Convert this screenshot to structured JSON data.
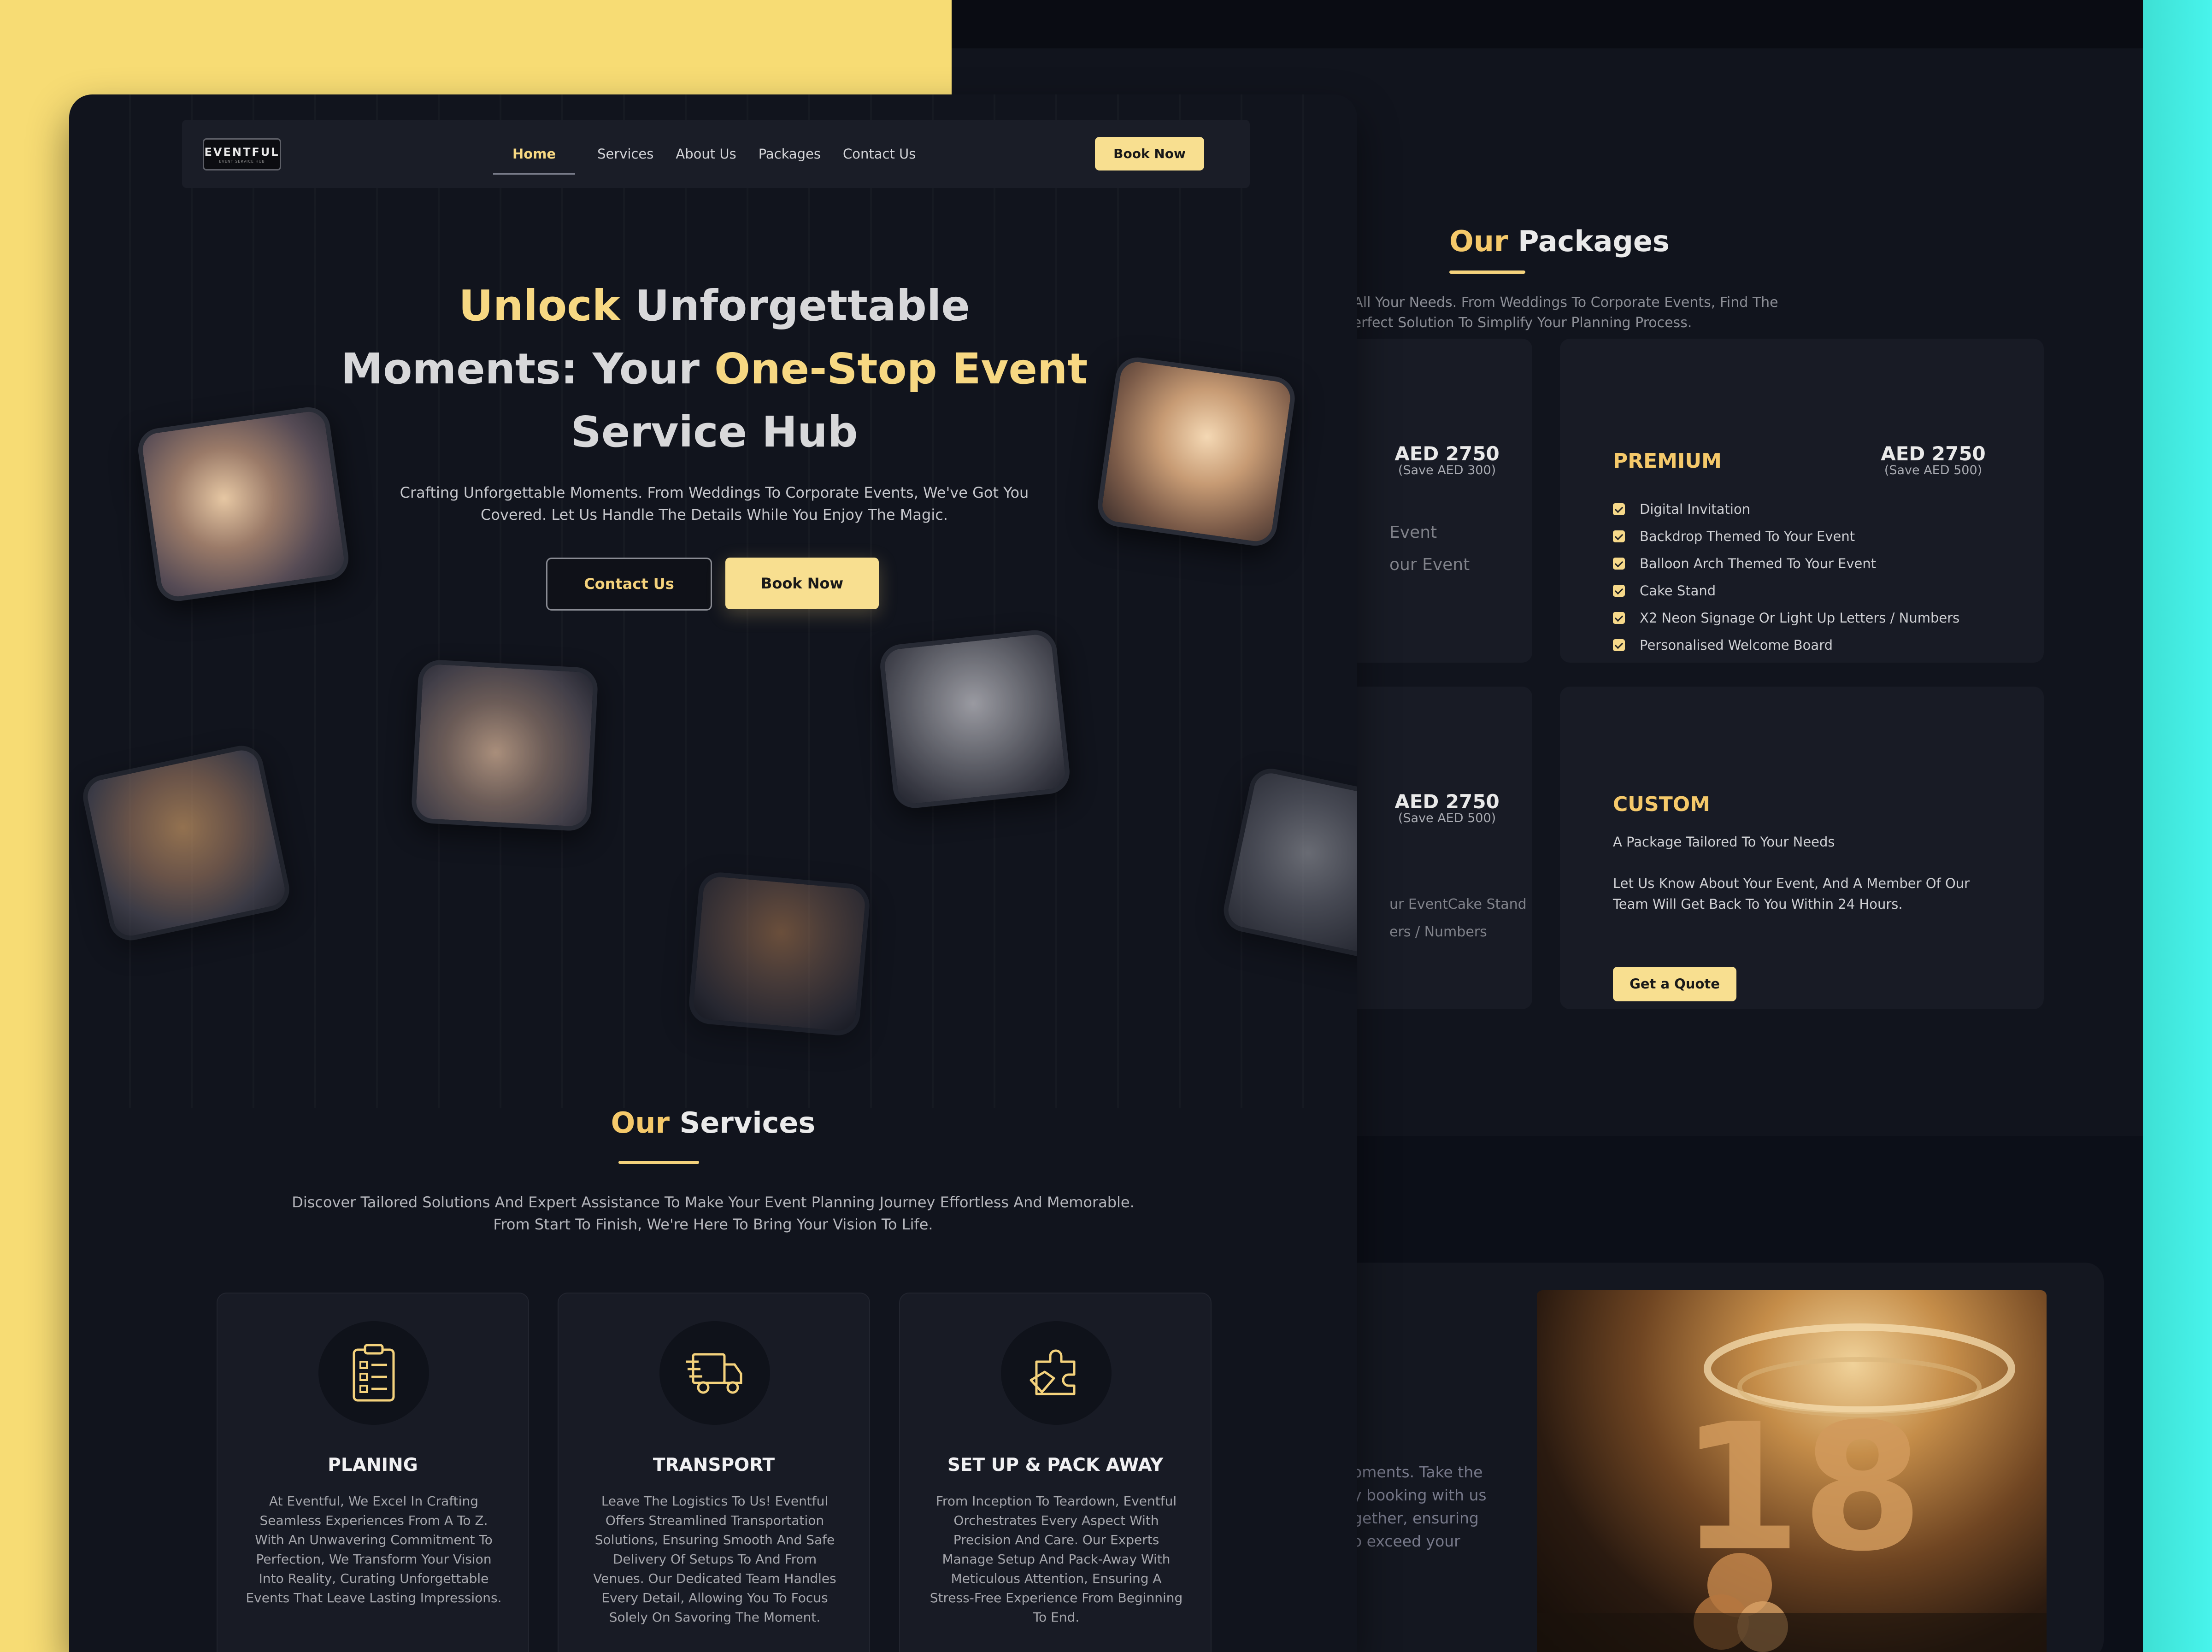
{
  "packages": {
    "heading_pre": "Our",
    "heading_post": "Packages",
    "subtitle_line1": "Packages For All Your Needs. From Weddings To Corporate Events, Find The",
    "subtitle_line2": "Perfect Solution To Simplify Your Planning Process.",
    "cards": [
      {
        "price": "AED 2750",
        "save": "(Save AED 300)",
        "partial_lines": [
          "Event",
          "our Event"
        ]
      },
      {
        "title": "PREMIUM",
        "price": "AED 2750",
        "save": "(Save AED 500)",
        "features": [
          "Digital Invitation",
          "Backdrop Themed To Your Event",
          "Balloon Arch Themed To Your Event",
          "Cake Stand",
          "X2 Neon Signage Or Light Up Letters / Numbers",
          "Personalised Welcome Board"
        ]
      },
      {
        "price": "AED 2750",
        "save": "(Save AED 500)",
        "partial_lines": [
          "ur EventCake Stand",
          "ers / Numbers"
        ]
      },
      {
        "title": "CUSTOM",
        "tagline": "A Package Tailored To Your Needs",
        "desc_line1": "Let Us Know About Your Event, And A Member Of Our",
        "desc_line2": "Team Will Get Back To You Within 24 Hours.",
        "button": "Get a Quote"
      }
    ]
  },
  "about": {
    "lines": [
      "oments. Take the",
      "y booking with us",
      "gether, ensuring",
      "o exceed your"
    ]
  },
  "nav": {
    "logo_title": "EVENTFUL",
    "logo_subtitle": "EVENT SERVICE HUB",
    "links": [
      "Home",
      "Services",
      "About Us",
      "Packages",
      "Contact Us"
    ],
    "book_button": "Book Now"
  },
  "hero": {
    "title_part1": "Unlock",
    "title_part2": " Unforgettable",
    "title_part3": "Moments: Your ",
    "title_part4": "One-Stop Event",
    "title_part5": "Service Hub",
    "subtitle_line1": "Crafting Unforgettable Moments. From Weddings To Corporate Events, We've Got You",
    "subtitle_line2": "Covered. Let Us Handle The Details While You Enjoy The Magic.",
    "contact_button": "Contact Us",
    "book_button": "Book Now"
  },
  "services": {
    "heading_pre": "Our",
    "heading_post": "Services",
    "subtitle_line1": "Discover Tailored Solutions And Expert Assistance To Make Your Event Planning Journey Effortless And Memorable.",
    "subtitle_line2": "From Start To Finish, We're Here To Bring Your Vision To Life.",
    "cards": [
      {
        "icon": "clipboard-icon",
        "title": "PLANING",
        "lines": [
          "At Eventful, We Excel In Crafting",
          "Seamless Experiences From A To Z.",
          "With An Unwavering Commitment To",
          "Perfection, We Transform Your Vision",
          "Into Reality, Curating Unforgettable",
          "Events That Leave Lasting Impressions."
        ]
      },
      {
        "icon": "truck-icon",
        "title": "TRANSPORT",
        "lines": [
          "Leave The Logistics To Us! Eventful",
          "Offers Streamlined Transportation",
          "Solutions, Ensuring Smooth And Safe",
          "Delivery Of Setups To And From",
          "Venues. Our Dedicated Team Handles",
          "Every Detail, Allowing You To Focus",
          "Solely On Savoring The Moment."
        ]
      },
      {
        "icon": "puzzle-icon",
        "title": "SET UP & PACK AWAY",
        "lines": [
          "From Inception To Teardown, Eventful",
          "Orchestrates Every Aspect With",
          "Precision And Care. Our Experts",
          "Manage Setup And Pack-Away With",
          "Meticulous Attention, Ensuring A",
          "Stress-Free Experience From Beginning",
          "To End."
        ]
      }
    ]
  },
  "colors": {
    "accent": "#f7d882",
    "background": "#11141d",
    "card": "#181b25",
    "left_backdrop": "#f7dc74",
    "right_backdrop": "#48f4ec"
  }
}
